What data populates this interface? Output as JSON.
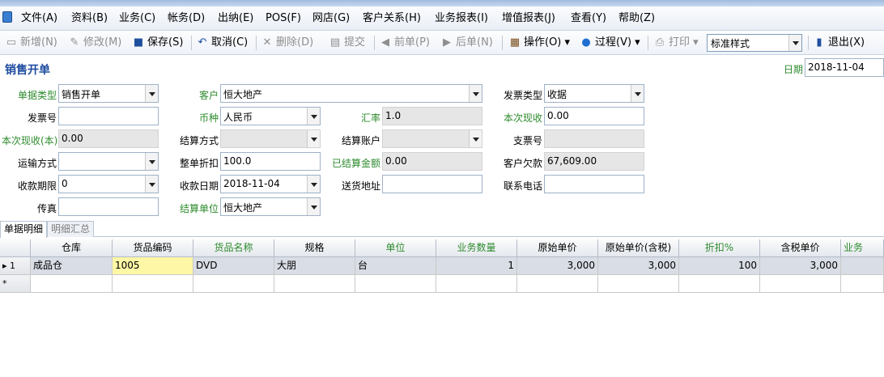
{
  "menu": [
    "文件(A)",
    "资料(B)",
    "业务(C)",
    "帐务(D)",
    "出纳(E)",
    "POS(F)",
    "网店(G)",
    "客户关系(H)",
    "业务报表(I)",
    "增值报表(J)",
    "查看(Y)",
    "帮助(Z)"
  ],
  "toolbar": {
    "new": "新增(N)",
    "edit": "修改(M)",
    "save": "保存(S)",
    "cancel": "取消(C)",
    "delete": "删除(D)",
    "submit": "提交",
    "prev": "前单(P)",
    "next": "后单(N)",
    "operate": "操作(O)",
    "process": "过程(V)",
    "print": "打印",
    "style": "标准样式",
    "exit": "退出(X)"
  },
  "form": {
    "title": "销售开单",
    "date_label": "日期",
    "date_value": "2018-11-04",
    "doc_type_label": "单据类型",
    "doc_type": "销售开单",
    "customer_label": "客户",
    "customer": "恒大地产",
    "invoice_type_label": "发票类型",
    "invoice_type": "收据",
    "invoice_no_label": "发票号",
    "invoice_no": "",
    "currency_label": "币种",
    "currency": "人民币",
    "rate_label": "汇率",
    "rate": "1.0",
    "received_label": "本次现收",
    "received": "0.00",
    "received_base_label": "本次现收(本)",
    "received_base": "0.00",
    "settle_method_label": "结算方式",
    "settle_method": "",
    "settle_account_label": "结算账户",
    "settle_account": "",
    "cheque_no_label": "支票号",
    "cheque_no": "",
    "shipping_label": "运输方式",
    "shipping": "",
    "discount_label": "整单折扣",
    "discount": "100.0",
    "settled_amount_label": "已结算金额",
    "settled_amount": "0.00",
    "customer_debt_label": "客户欠款",
    "customer_debt": "67,609.00",
    "term_label": "收款期限",
    "term": "0",
    "collect_date_label": "收款日期",
    "collect_date": "2018-11-04",
    "ship_addr_label": "送货地址",
    "ship_addr": "",
    "phone_label": "联系电话",
    "phone": "",
    "fax_label": "传真",
    "fax": "",
    "settle_unit_label": "结算单位",
    "settle_unit": "恒大地产"
  },
  "tabs": [
    "单据明细",
    "明细汇总"
  ],
  "grid": {
    "headers": [
      "仓库",
      "货品编码",
      "货品名称",
      "规格",
      "单位",
      "业务数量",
      "原始单价",
      "原始单价(含税)",
      "折扣%",
      "含税单价",
      "业务"
    ],
    "row": {
      "index": "1",
      "cells": [
        "成品仓",
        "1005",
        "DVD",
        "大朋",
        "台",
        "1",
        "3,000",
        "3,000",
        "100",
        "3,000",
        ""
      ]
    },
    "new_row_marker": "*"
  }
}
